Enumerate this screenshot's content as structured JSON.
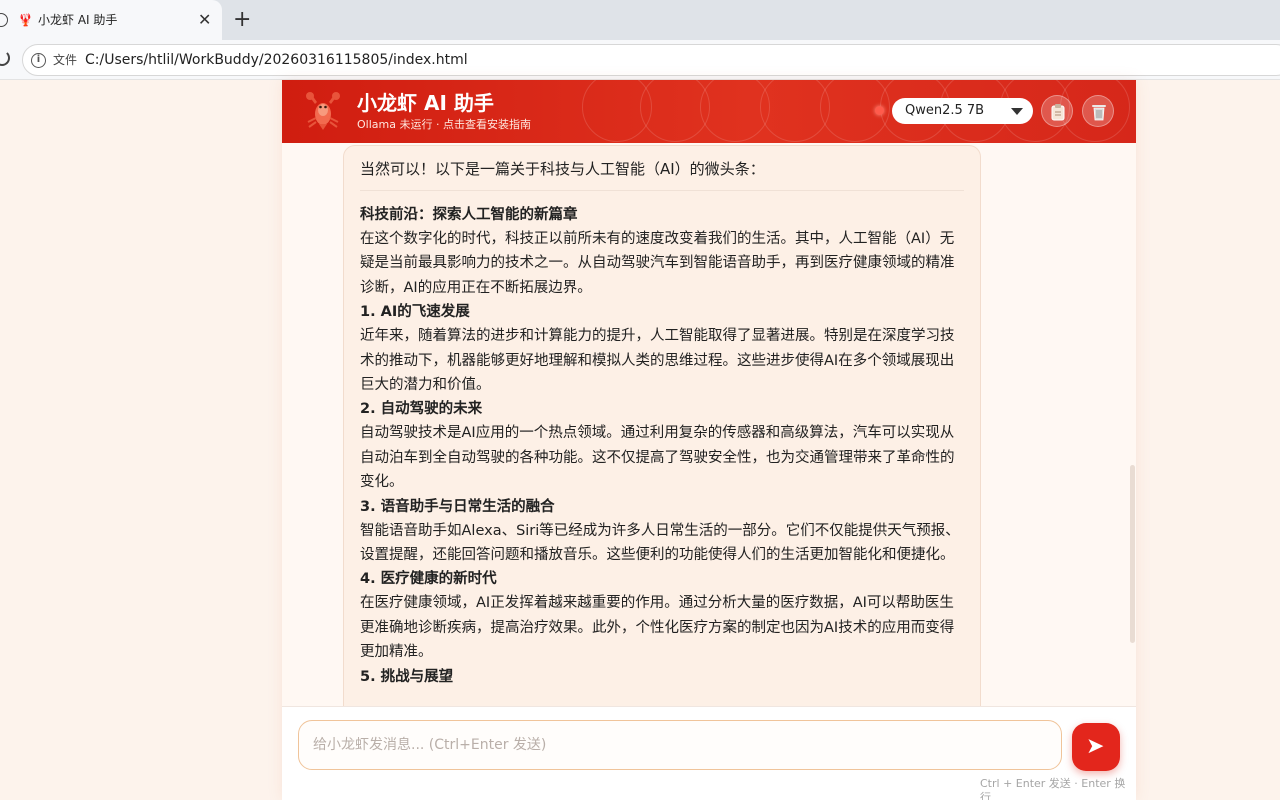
{
  "browser": {
    "tab_title": "小龙虾 AI 助手",
    "tab_favicon": "🦞",
    "close_glyph": "✕",
    "newtab_glyph": "+",
    "omni_label": "文件",
    "url": "C:/Users/htlil/WorkBuddy/20260316115805/index.html",
    "info_glyph": "i"
  },
  "header": {
    "title": "小龙虾 AI 助手",
    "subtitle": "Ollama 未运行 · 点击查看安装指南",
    "model_selected": "Qwen2.5 7B",
    "status_color": "#ff5b4c",
    "accent": "#d01d10",
    "icons": [
      "clipboard-icon",
      "trash-icon"
    ]
  },
  "message": {
    "intro": "当然可以！以下是一篇关于科技与人工智能（AI）的微头条：",
    "blocks": [
      {
        "type": "h",
        "text": "科技前沿：探索人工智能的新篇章"
      },
      {
        "type": "p",
        "text": "在这个数字化的时代，科技正以前所未有的速度改变着我们的生活。其中，人工智能（AI）无疑是当前最具影响力的技术之一。从自动驾驶汽车到智能语音助手，再到医疗健康领域的精准诊断，AI的应用正在不断拓展边界。"
      },
      {
        "type": "h",
        "text": "1. AI的飞速发展"
      },
      {
        "type": "p",
        "text": "近年来，随着算法的进步和计算能力的提升，人工智能取得了显著进展。特别是在深度学习技术的推动下，机器能够更好地理解和模拟人类的思维过程。这些进步使得AI在多个领域展现出巨大的潜力和价值。"
      },
      {
        "type": "h",
        "text": "2. 自动驾驶的未来"
      },
      {
        "type": "p",
        "text": "自动驾驶技术是AI应用的一个热点领域。通过利用复杂的传感器和高级算法，汽车可以实现从自动泊车到全自动驾驶的各种功能。这不仅提高了驾驶安全性，也为交通管理带来了革命性的变化。"
      },
      {
        "type": "h",
        "text": "3. 语音助手与日常生活的融合"
      },
      {
        "type": "p",
        "text": "智能语音助手如Alexa、Siri等已经成为许多人日常生活的一部分。它们不仅能提供天气预报、设置提醒，还能回答问题和播放音乐。这些便利的功能使得人们的生活更加智能化和便捷化。"
      },
      {
        "type": "h",
        "text": "4. 医疗健康的新时代"
      },
      {
        "type": "p",
        "text": "在医疗健康领域，AI正发挥着越来越重要的作用。通过分析大量的医疗数据，AI可以帮助医生更准确地诊断疾病，提高治疗效果。此外，个性化医疗方案的制定也因为AI技术的应用而变得更加精准。"
      },
      {
        "type": "h",
        "text": "5. 挑战与展望"
      }
    ]
  },
  "composer": {
    "placeholder": "给小龙虾发消息... (Ctrl+Enter 发送)",
    "send_glyph": "➤",
    "hint": "Ctrl + Enter 发送 · Enter 换行"
  }
}
